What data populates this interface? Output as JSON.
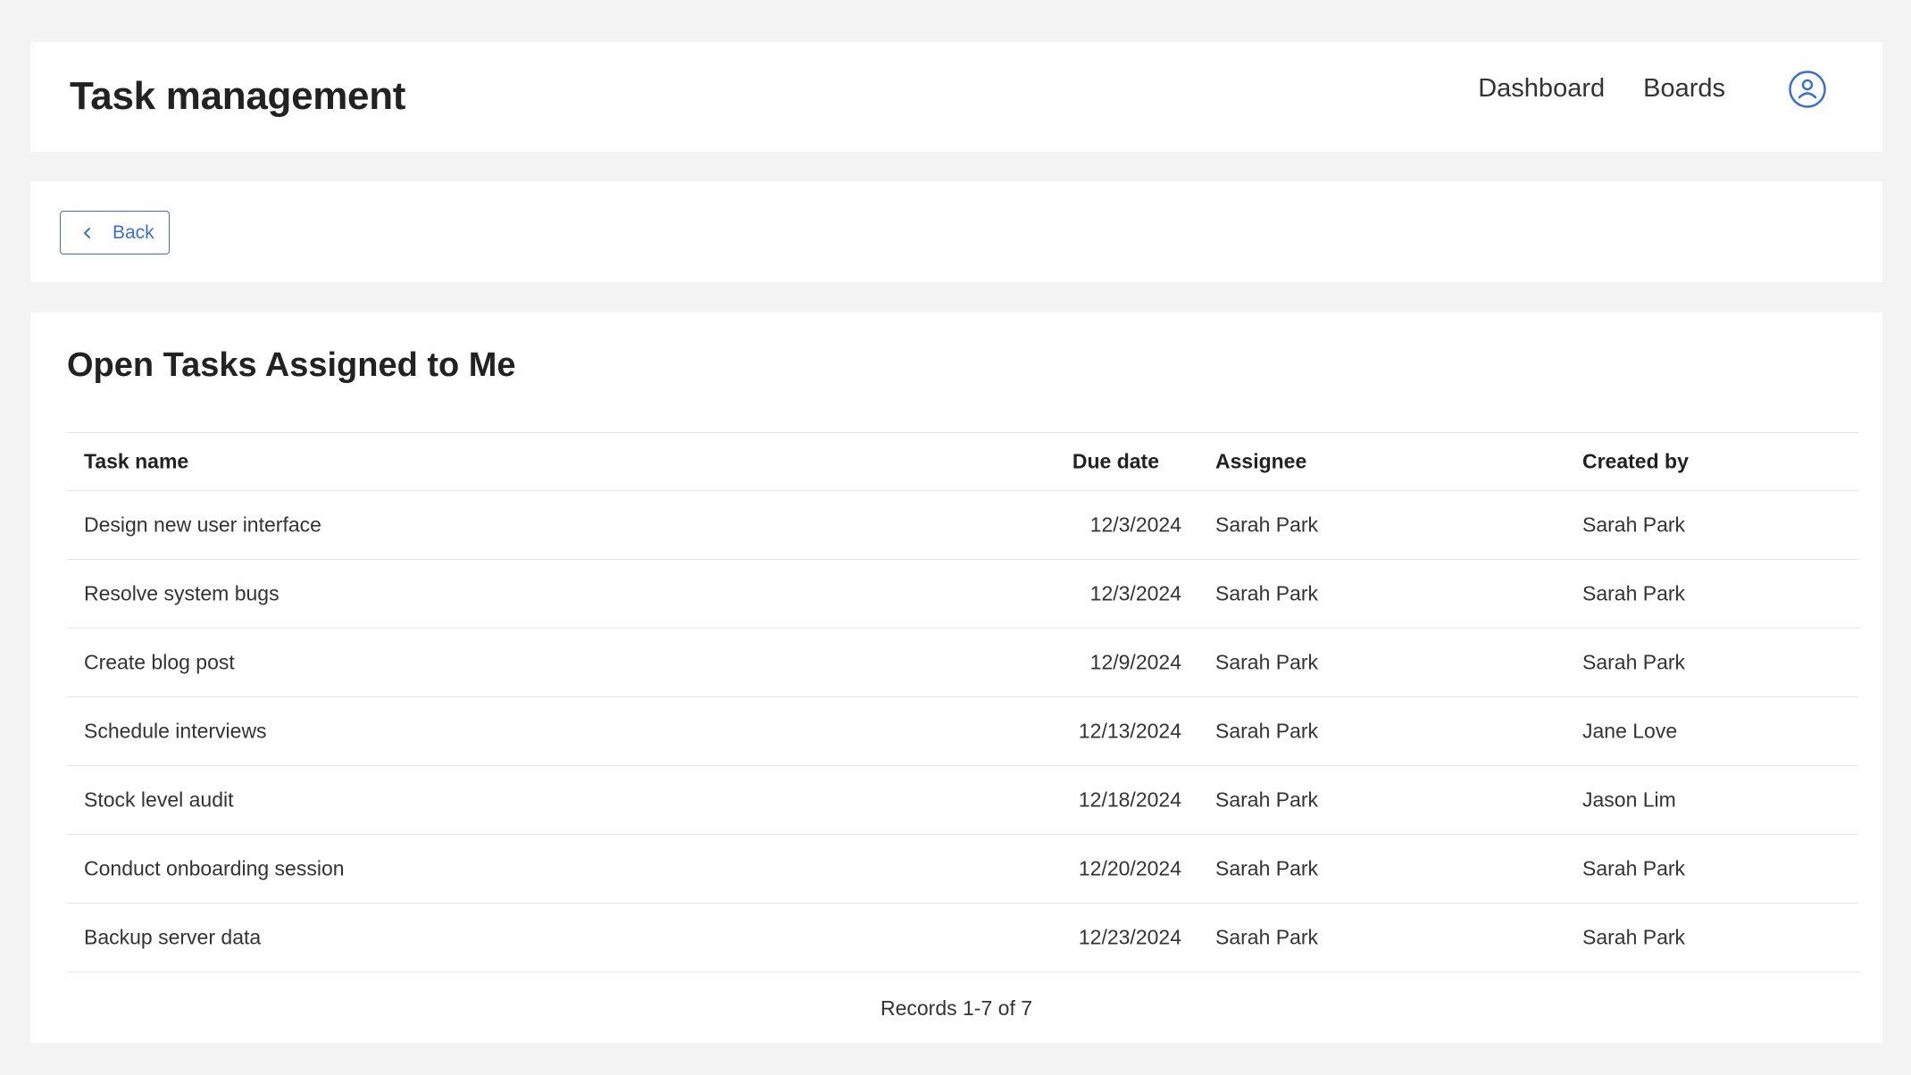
{
  "header": {
    "app_title": "Task management",
    "nav": [
      "Dashboard",
      "Boards"
    ],
    "avatar_icon": "user-circle-icon",
    "accent_color": "#3b6fd8"
  },
  "toolbar": {
    "back_label": "Back",
    "back_icon": "chevron-left-icon"
  },
  "main": {
    "title": "Open Tasks Assigned to Me",
    "columns": {
      "task": "Task name",
      "due": "Due date",
      "assignee": "Assignee",
      "created": "Created by"
    },
    "rows": [
      {
        "task": "Design new user interface",
        "due": "12/3/2024",
        "assignee": "Sarah Park",
        "created": "Sarah Park"
      },
      {
        "task": "Resolve system bugs",
        "due": "12/3/2024",
        "assignee": "Sarah Park",
        "created": "Sarah Park"
      },
      {
        "task": "Create blog post",
        "due": "12/9/2024",
        "assignee": "Sarah Park",
        "created": "Sarah Park"
      },
      {
        "task": "Schedule interviews",
        "due": "12/13/2024",
        "assignee": "Sarah Park",
        "created": "Jane Love"
      },
      {
        "task": "Stock level audit",
        "due": "12/18/2024",
        "assignee": "Sarah Park",
        "created": "Jason Lim"
      },
      {
        "task": "Conduct onboarding session",
        "due": "12/20/2024",
        "assignee": "Sarah Park",
        "created": "Sarah Park"
      },
      {
        "task": "Backup server data",
        "due": "12/23/2024",
        "assignee": "Sarah Park",
        "created": "Sarah Park"
      }
    ],
    "records_text": "Records 1-7 of 7"
  }
}
